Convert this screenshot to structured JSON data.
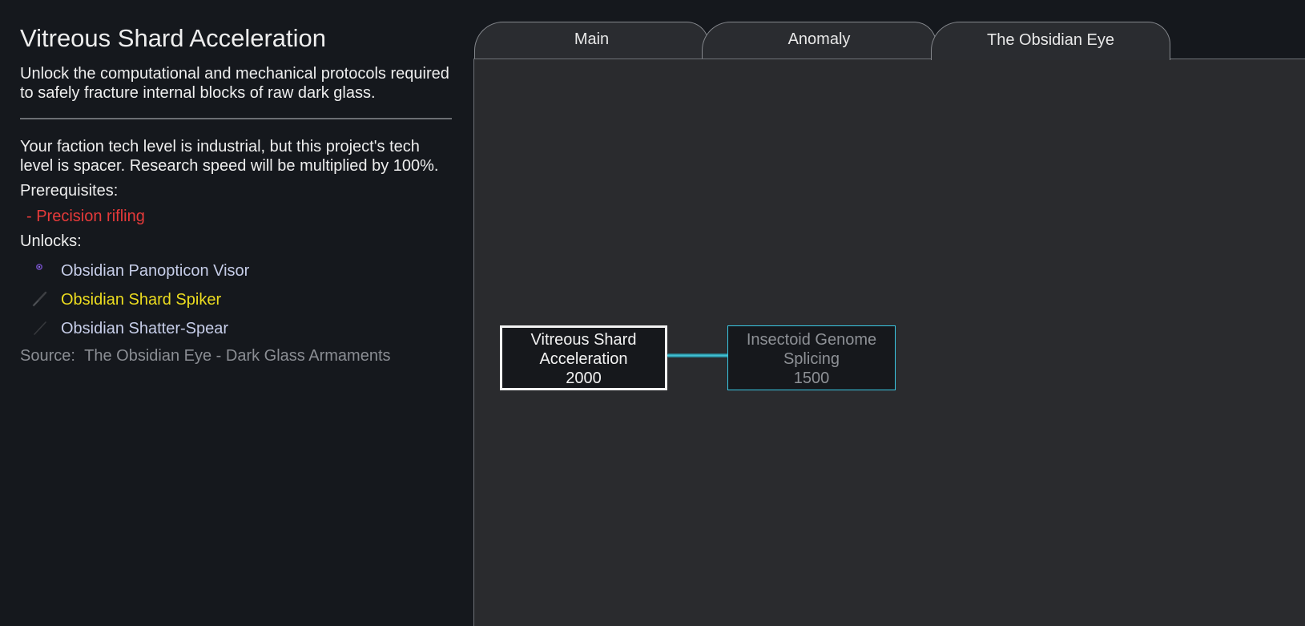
{
  "project": {
    "title": "Vitreous Shard Acceleration",
    "description": "Unlock the computational and mechanical protocols required to safely fracture internal blocks of raw dark glass.",
    "tech_level_note": "Your faction tech level is industrial, but this project's tech level is spacer. Research speed will be multiplied by 100%.",
    "prerequisites_label": "Prerequisites:",
    "prerequisites": [
      "- Precision rifling"
    ],
    "unlocks_label": "Unlocks:",
    "unlocks": [
      {
        "label": "Obsidian Panopticon Visor",
        "icon": "visor-icon",
        "color": "#c6cde8"
      },
      {
        "label": "Obsidian Shard Spiker",
        "icon": "spike-weapon-icon",
        "color": "#ecdc1f"
      },
      {
        "label": "Obsidian Shatter-Spear",
        "icon": "spear-icon",
        "color": "#c6cde8"
      }
    ],
    "source_label": "Source:",
    "source_value": "The Obsidian Eye - Dark Glass Armaments"
  },
  "tabs": [
    {
      "label": "Main",
      "selected": false
    },
    {
      "label": "Anomaly",
      "selected": false
    },
    {
      "label": "The Obsidian Eye",
      "selected": true
    }
  ],
  "tree": {
    "nodes": [
      {
        "name": "Vitreous Shard Acceleration",
        "line1": "Vitreous Shard",
        "line2": "Acceleration",
        "cost": "2000",
        "state": "selected"
      },
      {
        "name": "Insectoid Genome Splicing",
        "line1": "Insectoid Genome",
        "line2": "Splicing",
        "cost": "1500",
        "state": "locked"
      }
    ]
  },
  "colors": {
    "background": "#15181d",
    "tree_background": "#2a2b2e",
    "prerequisite_missing": "#e63a3a",
    "highlight_yellow": "#ecdc1f",
    "connector": "#46c9dc",
    "locked_border": "#3ac8e4"
  }
}
